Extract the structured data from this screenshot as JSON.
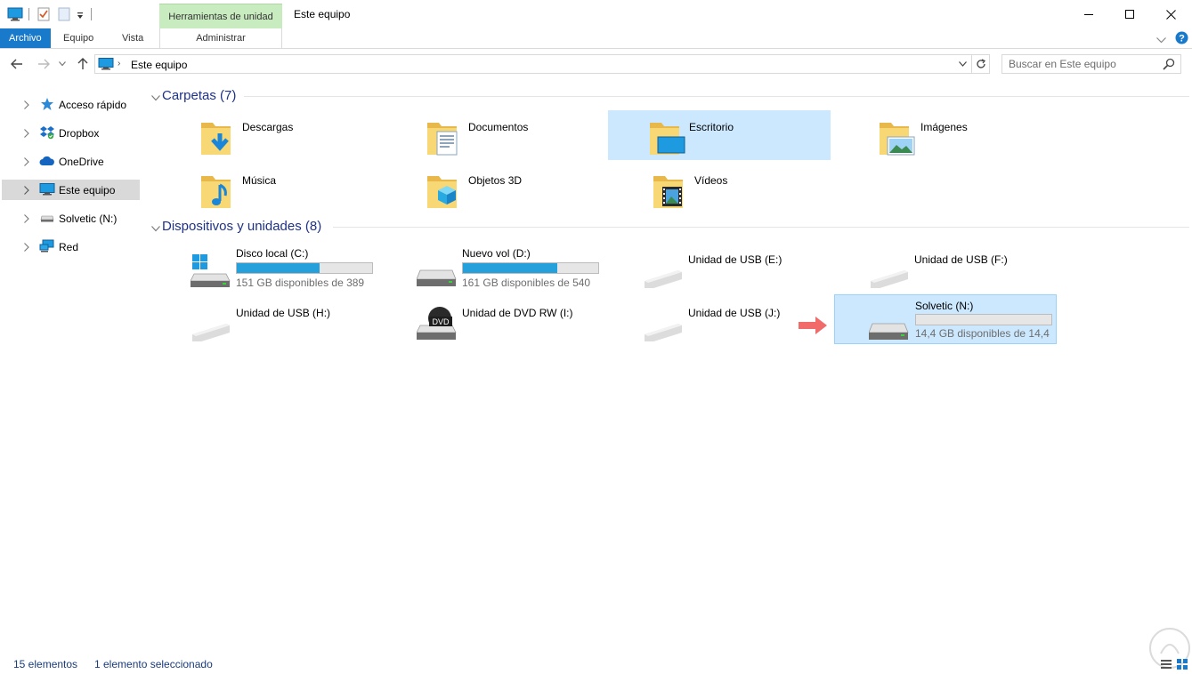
{
  "titlebar": {
    "context_tab_label": "Herramientas de unidad",
    "title": "Este equipo"
  },
  "ribbon": {
    "tabs": [
      {
        "label": "Archivo"
      },
      {
        "label": "Equipo"
      },
      {
        "label": "Vista"
      }
    ],
    "context_tab": "Administrar"
  },
  "address": {
    "path": "Este equipo",
    "search_placeholder": "Buscar en Este equipo"
  },
  "sidebar": {
    "items": [
      {
        "label": "Acceso rápido",
        "icon": "star-icon"
      },
      {
        "label": "Dropbox",
        "icon": "dropbox-icon"
      },
      {
        "label": "OneDrive",
        "icon": "cloud-icon"
      },
      {
        "label": "Este equipo",
        "icon": "computer-icon",
        "selected": true
      },
      {
        "label": "Solvetic (N:)",
        "icon": "drive-icon"
      },
      {
        "label": "Red",
        "icon": "network-icon"
      }
    ]
  },
  "groups": {
    "folders_title": "Carpetas (7)",
    "devices_title": "Dispositivos y unidades (8)"
  },
  "folders": [
    {
      "name": "Descargas",
      "icon": "downloads-folder-icon"
    },
    {
      "name": "Documentos",
      "icon": "documents-folder-icon"
    },
    {
      "name": "Escritorio",
      "icon": "desktop-folder-icon",
      "highlighted": true
    },
    {
      "name": "Imágenes",
      "icon": "pictures-folder-icon"
    },
    {
      "name": "Música",
      "icon": "music-folder-icon"
    },
    {
      "name": "Objetos 3D",
      "icon": "3d-objects-folder-icon"
    },
    {
      "name": "Vídeos",
      "icon": "videos-folder-icon"
    }
  ],
  "drives": [
    {
      "name": "Disco local (C:)",
      "free": "151 GB disponibles de 389",
      "used_fraction": 0.61,
      "icon": "windows-drive-icon"
    },
    {
      "name": "Nuevo vol (D:)",
      "free": "161 GB disponibles de 540",
      "used_fraction": 0.7,
      "icon": "hard-drive-icon"
    },
    {
      "name": "Unidad de USB (E:)",
      "icon": "usb-drive-icon"
    },
    {
      "name": "Unidad de USB (F:)",
      "icon": "usb-drive-icon"
    },
    {
      "name": "Unidad de USB (H:)",
      "icon": "usb-drive-icon"
    },
    {
      "name": "Unidad de DVD RW (I:)",
      "icon": "dvd-drive-icon",
      "dvd_label": "DVD"
    },
    {
      "name": "Unidad de USB (J:)",
      "icon": "usb-drive-icon"
    },
    {
      "name": "Solvetic (N:)",
      "free": "14,4 GB disponibles de 14,4",
      "used_fraction": 0.0,
      "icon": "hard-drive-icon",
      "selected": true
    }
  ],
  "status": {
    "count": "15 elementos",
    "selection": "1 elemento seleccionado"
  },
  "colors": {
    "accent": "#1979ca",
    "selection": "#cce8ff",
    "bar_fill": "#26a0da",
    "context_tab": "#c8ecc0",
    "arrow": "#f26b6b"
  }
}
